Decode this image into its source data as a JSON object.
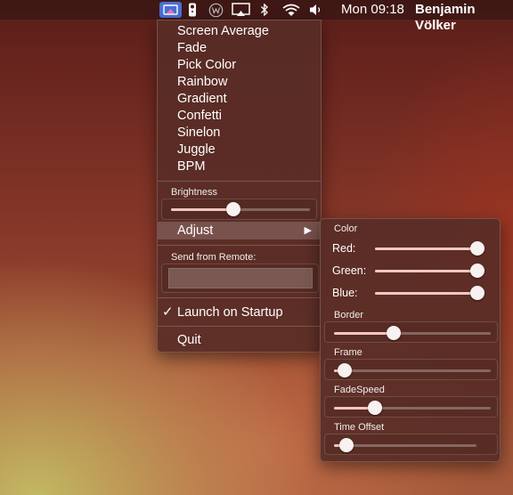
{
  "menubar": {
    "icons": [
      "app-status-icon",
      "remote-icon",
      "weather-icon",
      "airplay-icon",
      "bluetooth-icon",
      "wifi-icon",
      "volume-icon"
    ],
    "clock": "Mon 09:18",
    "user": "Benjamin Völker",
    "active_color": "#4a6fd6"
  },
  "main_menu": {
    "modes": [
      "Screen Average",
      "Fade",
      "Pick Color",
      "Rainbow",
      "Gradient",
      "Confetti",
      "Sinelon",
      "Juggle",
      "BPM"
    ],
    "brightness": {
      "label": "Brightness",
      "value": 0.45
    },
    "adjust": {
      "label": "Adjust",
      "arrow": "▶"
    },
    "remote": {
      "label": "Send from Remote:",
      "value": ""
    },
    "launch": {
      "label": "Launch on Startup",
      "checked": true,
      "check_glyph": "✓"
    },
    "quit": "Quit"
  },
  "adjust_menu": {
    "color": {
      "label": "Color",
      "red": {
        "label": "Red:",
        "value": 1.0
      },
      "green": {
        "label": "Green:",
        "value": 1.0
      },
      "blue": {
        "label": "Blue:",
        "value": 1.0
      }
    },
    "border": {
      "label": "Border",
      "value": 0.38
    },
    "frame": {
      "label": "Frame",
      "value": 0.07
    },
    "fadespeed": {
      "label": "FadeSpeed",
      "value": 0.26
    },
    "time_offset": {
      "label": "Time Offset",
      "value": 0.09
    }
  }
}
